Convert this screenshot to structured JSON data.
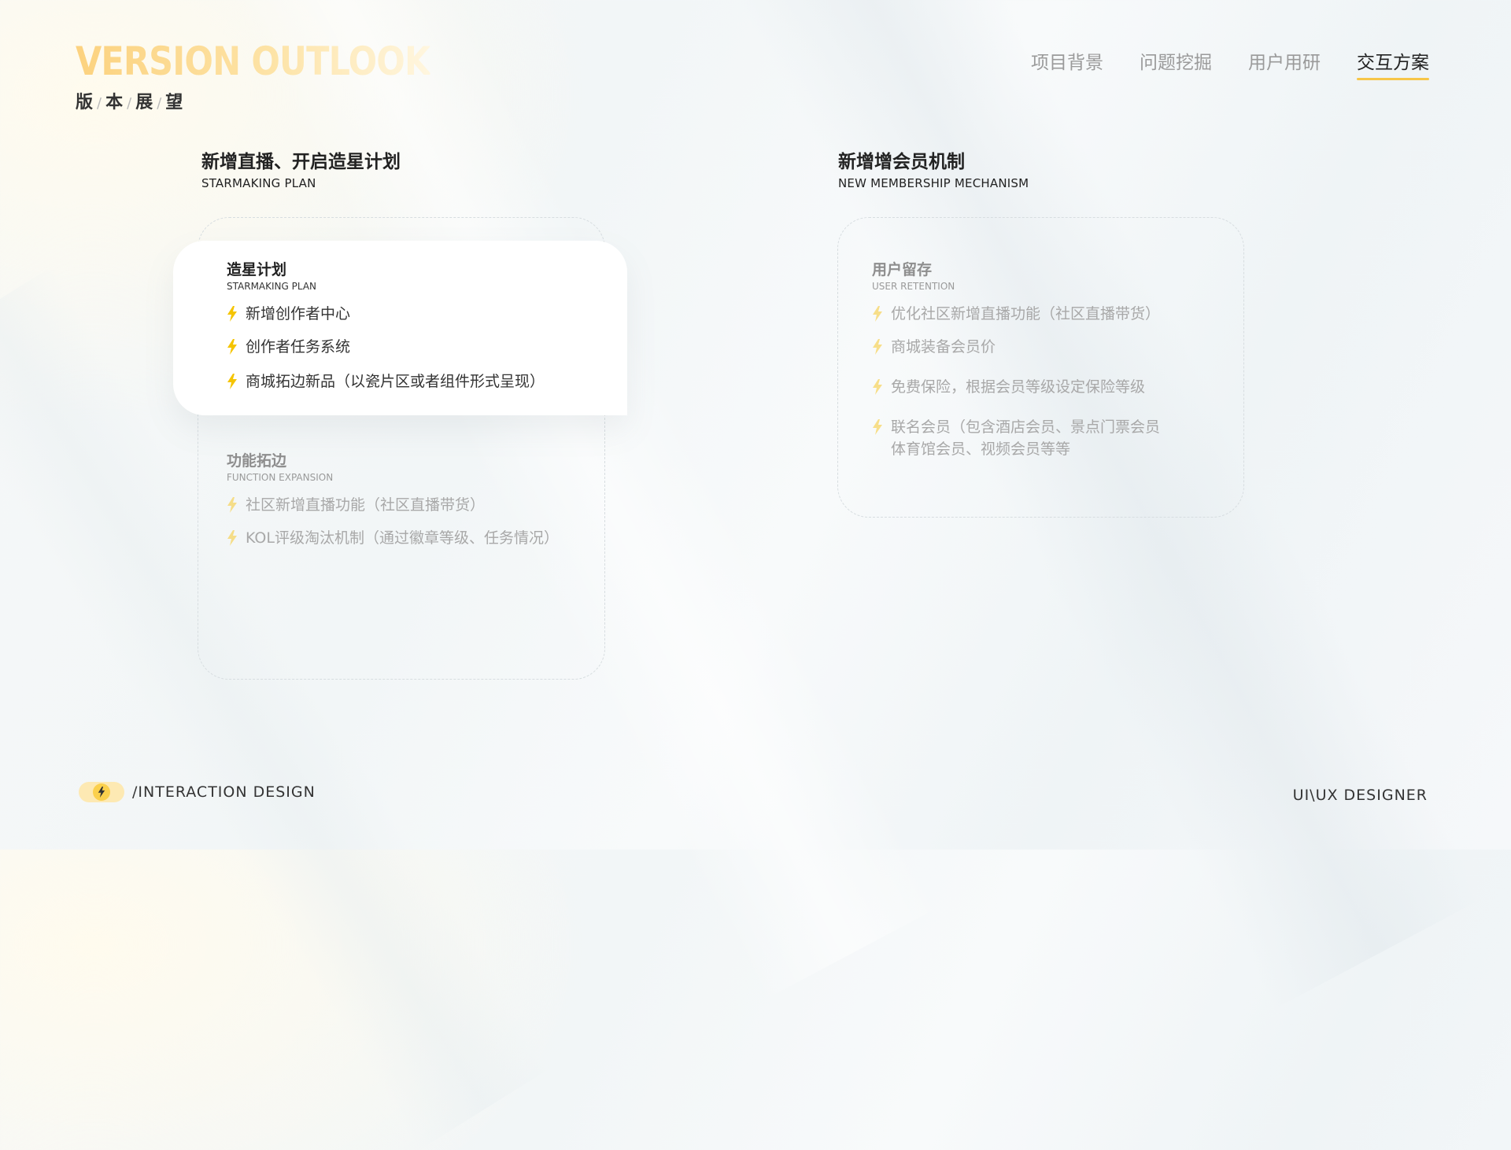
{
  "brand": {
    "title": "VERSION OUTLOOK",
    "subtitle_chars": [
      "版",
      "本",
      "展",
      "望"
    ],
    "separator": "/"
  },
  "nav": {
    "items": [
      {
        "label": "项目背景",
        "active": false
      },
      {
        "label": "问题挖掘",
        "active": false
      },
      {
        "label": "用户用研",
        "active": false
      },
      {
        "label": "交互方案",
        "active": true
      }
    ]
  },
  "left_section": {
    "title": "新增直播、开启造星计划",
    "subtitle": "STARMAKING PLAN",
    "featured": {
      "title": "造星计划",
      "subtitle": "STARMAKING PLAN",
      "bullets": [
        "新增创作者中心",
        "创作者任务系统",
        "商城拓边新品（以瓷片区或者组件形式呈现）"
      ]
    },
    "secondary": {
      "title": "功能拓边",
      "subtitle": "FUNCTION EXPANSION",
      "bullets": [
        "社区新增直播功能（社区直播带货）",
        " KOL评级淘汰机制（通过徽章等级、任务情况）"
      ]
    }
  },
  "right_section": {
    "title": "新增增会员机制",
    "subtitle": "NEW MEMBERSHIP MECHANISM",
    "group": {
      "title": "用户留存",
      "subtitle": "USER RETENTION",
      "bullets": [
        "优化社区新增直播功能（社区直播带货）",
        "商城装备会员价",
        "免费保险，根据会员等级设定保险等级",
        "联名会员（包含酒店会员、景点门票会员",
        "体育馆会员、视频会员等等"
      ]
    }
  },
  "footer": {
    "left_text": "/INTERACTION DESIGN",
    "right_text": "UI\\UX DESIGNER"
  },
  "colors": {
    "accent": "#f7c648",
    "bolt": "#f5c400",
    "text_dark": "#222222",
    "text_dim": "#a8a8a8"
  },
  "icons": {
    "bullet": "lightning-icon",
    "footer": "lightning-icon"
  }
}
